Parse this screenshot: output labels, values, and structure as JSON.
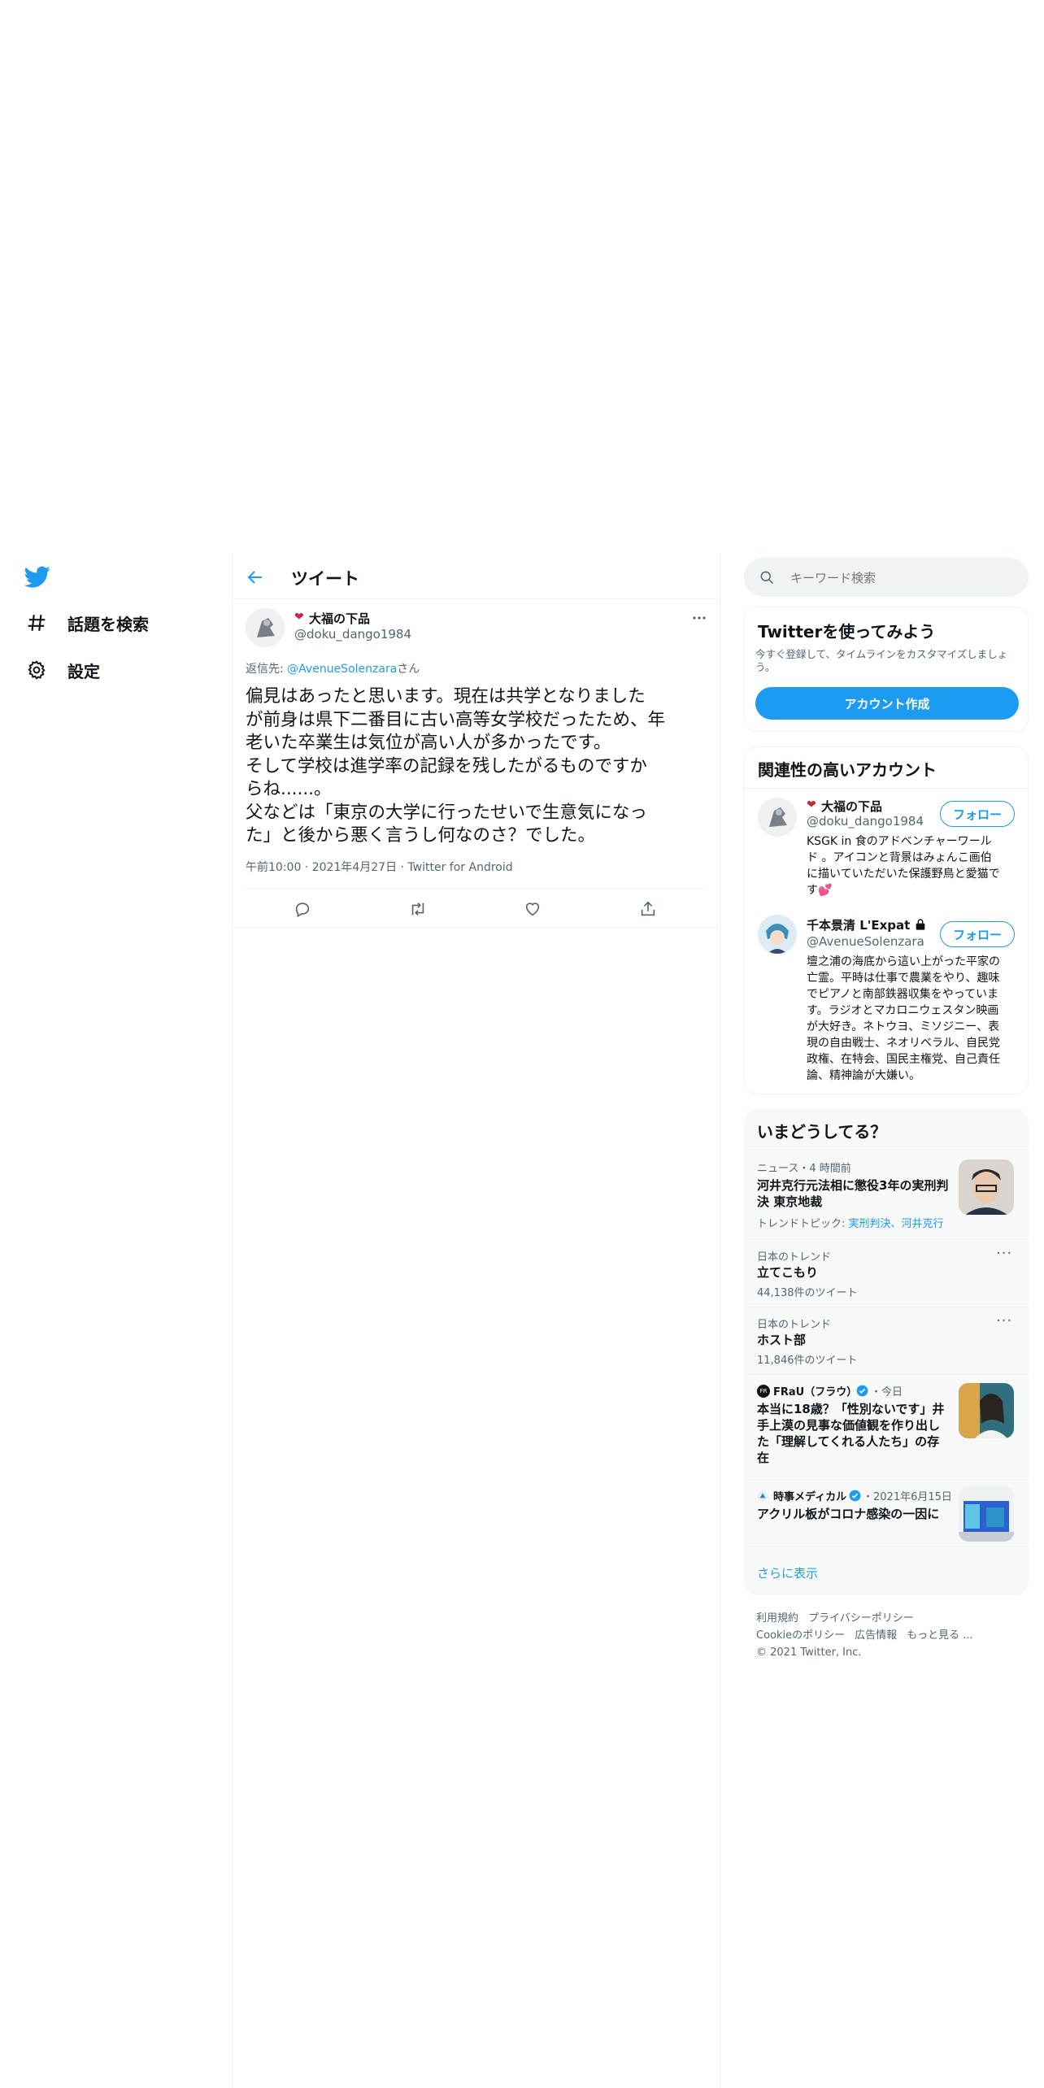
{
  "nav": {
    "items": [
      {
        "label": "話題を検索",
        "icon": "hashtag-icon"
      },
      {
        "label": "設定",
        "icon": "gear-icon"
      }
    ]
  },
  "header": {
    "title": "ツイート"
  },
  "tweet": {
    "display_name": "大福の下品",
    "handle": "@doku_dango1984",
    "reply_prefix": "返信先: ",
    "reply_to": "@AvenueSolenzara",
    "reply_suffix": "さん",
    "text_lines": [
      "偏見はあったと思います。現在は共学となりました",
      "が前身は県下二番目に古い高等女学校だったため、年",
      "老いた卒業生は気位が高い人が多かったです。",
      "そして学校は進学率の記録を残したがるものですか",
      "らね......。",
      "父などは「東京の大学に行ったせいで生意気になっ",
      "た」と後から悪く言うし何なのさ？でした。"
    ],
    "time": "午前10:00",
    "date": "2021年4月27日",
    "source": "Twitter for Android"
  },
  "search": {
    "placeholder": "キーワード検索"
  },
  "signup": {
    "title": "Twitterを使ってみよう",
    "desc_line1": "今すぐ登録して、タイムラインをカスタマイズしましょ",
    "desc_line2": "う。",
    "button": "アカウント作成"
  },
  "related": {
    "title": "関連性の高いアカウント",
    "accounts": [
      {
        "name": "大福の下品",
        "handle": "@doku_dango1984",
        "follow": "フォロー",
        "bio_lines": [
          "KSGK in 食のアドベンチャーワール",
          "ド 。アイコンと背景はみょんこ画伯",
          "に描いていただいた保護野鳥と愛猫で",
          "す💕"
        ]
      },
      {
        "name": "千本景清 L'Expatr...",
        "handle": "@AvenueSolenzara",
        "follow": "フォロー",
        "bio_lines": [
          "壇之浦の海底から這い上がった平家の",
          "亡霊。平時は仕事で農業をやり、趣味",
          "でピアノと南部鉄器収集をやっていま",
          "す。ラジオとマカロニウェスタン映画",
          "が大好き。ネトウヨ、ミソジニー、表",
          "現の自由戦士、ネオリベラル、自民党",
          "政権、在特会、国民主権党、自己責任",
          "論、精神論が大嫌い。"
        ]
      }
    ]
  },
  "trends": {
    "title": "いまどうしてる？",
    "items": [
      {
        "meta": "ニュース・4 時間前",
        "title_lines": [
          "河井克行元法相に懲役3年の実刑判",
          "決 東京地裁"
        ],
        "topic_prefix": "トレンドトピック: ",
        "topic_links": "実刑判決、河井克行"
      },
      {
        "meta": "日本のトレンド",
        "title": "立てこもり",
        "count": "44,138件のツイート"
      },
      {
        "meta": "日本のトレンド",
        "title": "ホスト部",
        "count": "11,846件のツイート"
      },
      {
        "source": "FRaU（フラウ）",
        "when": "・今日",
        "title_lines": [
          "本当に18歳？「性別ないです」井",
          "手上漠の見事な価値観を作り出し",
          "た「理解してくれる人たち」の存",
          "在"
        ]
      },
      {
        "source": "時事メディカル",
        "when": "・2021年6月15日",
        "title_lines": [
          "アクリル板がコロナ感染の一因に"
        ]
      }
    ],
    "show_more": "さらに表示"
  },
  "footer": {
    "terms": "利用規約",
    "privacy": "プライバシーポリシー",
    "cookies": "Cookieのポリシー",
    "ads": "広告情報",
    "more": "もっと見る ...",
    "copyright": "© 2021 Twitter, Inc."
  },
  "colors": {
    "accent": "#1d9bf0",
    "text": "#0f1419",
    "muted": "#536471"
  }
}
